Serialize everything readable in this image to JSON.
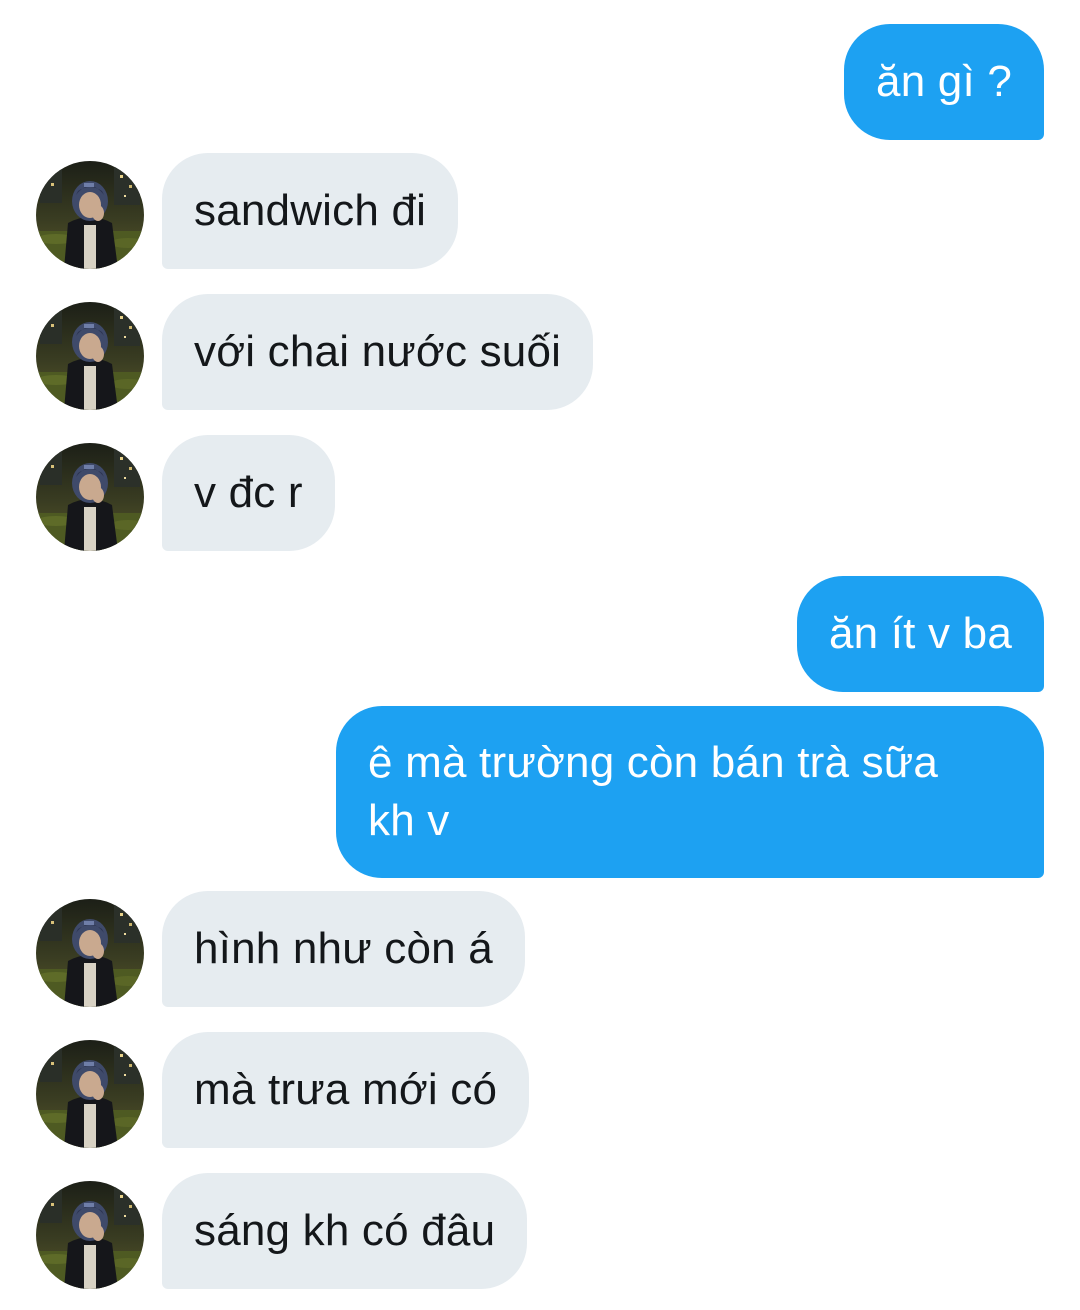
{
  "conversation": {
    "messages": [
      {
        "side": "out",
        "text": "ăn gì ?"
      },
      {
        "side": "in",
        "text": "sandwich đi",
        "avatar": "contact-avatar"
      },
      {
        "side": "in",
        "text": "với chai nước suối",
        "avatar": "contact-avatar"
      },
      {
        "side": "in",
        "text": "v đc r",
        "avatar": "contact-avatar"
      },
      {
        "side": "out",
        "text": "ăn ít v ba"
      },
      {
        "side": "out",
        "text": "ê mà trường còn bán trà sữa kh v"
      },
      {
        "side": "in",
        "text": "hình như còn á",
        "avatar": "contact-avatar"
      },
      {
        "side": "in",
        "text": "mà trưa mới có",
        "avatar": "contact-avatar"
      },
      {
        "side": "in",
        "text": "sáng kh có đâu",
        "avatar": "contact-avatar"
      }
    ]
  },
  "colors": {
    "outgoing_bubble": "#1da1f2",
    "incoming_bubble": "#e6ecf0",
    "outgoing_text": "#ffffff",
    "incoming_text": "#14171a"
  }
}
